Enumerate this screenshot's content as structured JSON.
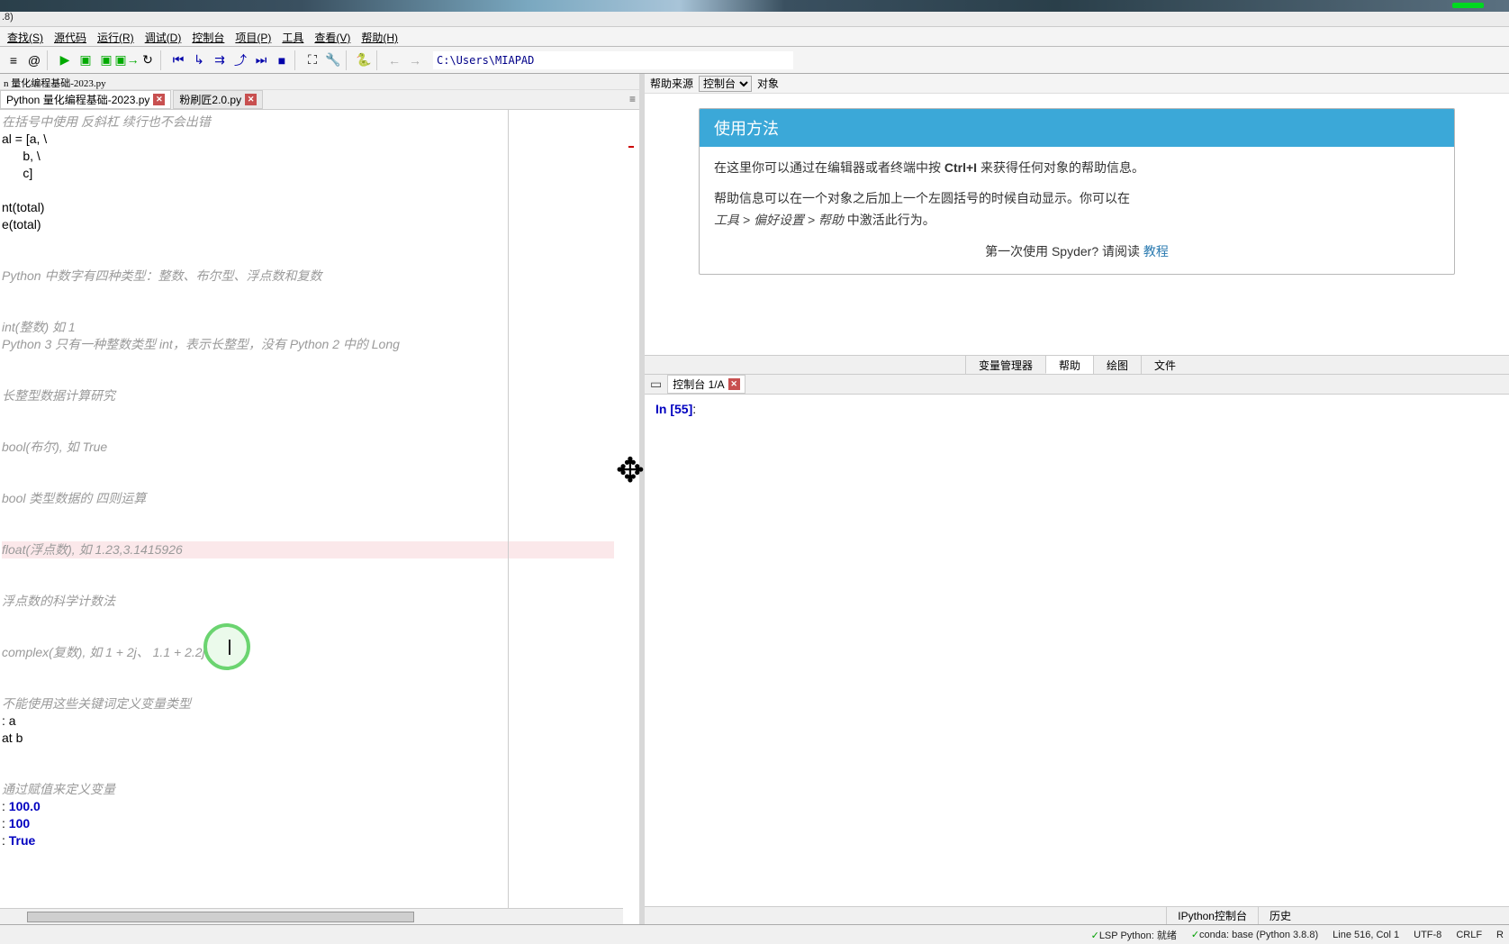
{
  "titlebar_text": ".8)",
  "menu": [
    "查找(S)",
    "源代码",
    "运行(R)",
    "调试(D)",
    "控制台",
    "项目(P)",
    "工具",
    "查看(V)",
    "帮助(H)"
  ],
  "toolbar_path": "C:\\Users\\MIAPAD",
  "breadcrumb": "n 量化编程基础-2023.py",
  "editor_tabs": [
    {
      "label": "Python 量化编程基础-2023.py",
      "active": true
    },
    {
      "label": "粉刷匠2.0.py",
      "active": false
    }
  ],
  "editor_lines": [
    {
      "t": "comment",
      "text": "在括号中使用 反斜杠 续行也不会出错"
    },
    {
      "t": "code",
      "text": "al = [a, \\"
    },
    {
      "t": "code",
      "text": "      b, \\"
    },
    {
      "t": "code",
      "text": "      c]"
    },
    {
      "t": "blank",
      "text": ""
    },
    {
      "t": "code",
      "text": "nt(total)"
    },
    {
      "t": "code",
      "text": "e(total)"
    },
    {
      "t": "blank",
      "text": ""
    },
    {
      "t": "blank",
      "text": ""
    },
    {
      "t": "comment",
      "text": "Python 中数字有四种类型：整数、布尔型、浮点数和复数"
    },
    {
      "t": "blank",
      "text": ""
    },
    {
      "t": "blank",
      "text": ""
    },
    {
      "t": "comment",
      "text": "int(整数) 如 1"
    },
    {
      "t": "comment",
      "text": "Python 3 只有一种整数类型 int，表示长整型，没有 Python 2 中的 Long"
    },
    {
      "t": "blank",
      "text": ""
    },
    {
      "t": "blank",
      "text": ""
    },
    {
      "t": "comment",
      "text": "长整型数据计算研究"
    },
    {
      "t": "blank",
      "text": ""
    },
    {
      "t": "blank",
      "text": ""
    },
    {
      "t": "comment",
      "text": "bool(布尔), 如 True"
    },
    {
      "t": "blank",
      "text": ""
    },
    {
      "t": "blank",
      "text": ""
    },
    {
      "t": "comment",
      "text": "bool 类型数据的 四则运算"
    },
    {
      "t": "blank",
      "text": ""
    },
    {
      "t": "blank",
      "text": ""
    },
    {
      "t": "comment",
      "text": "float(浮点数), 如 1.23,3.1415926",
      "hl": true
    },
    {
      "t": "blank",
      "text": ""
    },
    {
      "t": "blank",
      "text": ""
    },
    {
      "t": "comment",
      "text": "浮点数的科学计数法"
    },
    {
      "t": "blank",
      "text": ""
    },
    {
      "t": "blank",
      "text": ""
    },
    {
      "t": "comment",
      "text": "complex(复数), 如 1 + 2j、 1.1 + 2.2j"
    },
    {
      "t": "blank",
      "text": ""
    },
    {
      "t": "blank",
      "text": ""
    },
    {
      "t": "comment",
      "text": "不能使用这些关键词定义变量类型"
    },
    {
      "t": "code",
      "text": ": a"
    },
    {
      "t": "code",
      "text": "at b"
    },
    {
      "t": "blank",
      "text": ""
    },
    {
      "t": "blank",
      "text": ""
    },
    {
      "t": "comment",
      "text": "通过赋值来定义变量"
    },
    {
      "t": "num",
      "text": ": 100.0"
    },
    {
      "t": "num",
      "text": ": 100"
    },
    {
      "t": "bool",
      "text": ": True"
    }
  ],
  "help": {
    "header_label": "帮助来源",
    "select_options": [
      "控制台"
    ],
    "obj_label": "对象",
    "title": "使用方法",
    "p1": "在这里你可以通过在编辑器或者终端中按 ",
    "kbd": "Ctrl+I",
    "p1b": " 来获得任何对象的帮助信息。",
    "p2": "帮助信息可以在一个对象之后加上一个左圆括号的时候自动显示。你可以在",
    "p2path": "工具 > 偏好设置 > 帮助",
    "p2b": " 中激活此行为。",
    "tutorial_prefix": "第一次使用 Spyder? 请阅读",
    "tutorial_link": "教程"
  },
  "right_upper_tabs": [
    "变量管理器",
    "帮助",
    "绘图",
    "文件"
  ],
  "console": {
    "tab_label": "控制台 1/A",
    "prompt_in": "In ",
    "prompt_idx": "[55]",
    "prompt_colon": ": "
  },
  "right_lower_tabs": [
    "IPython控制台",
    "历史"
  ],
  "status": {
    "lsp": "✓LSP Python: 就绪",
    "conda": "✓conda: base (Python 3.8.8)",
    "line_col": "Line 516, Col 1",
    "enc": "UTF-8",
    "eol": "CRLF",
    "rw": "R"
  }
}
